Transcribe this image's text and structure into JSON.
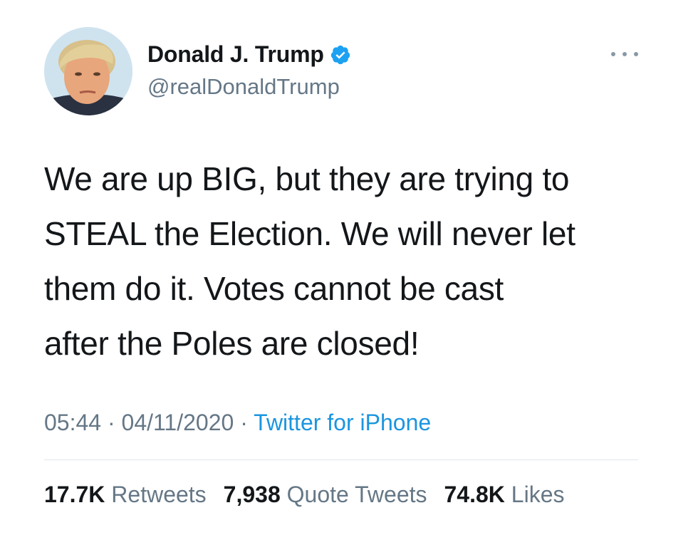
{
  "author": {
    "display_name": "Donald J. Trump",
    "handle": "@realDonaldTrump",
    "verified": true
  },
  "tweet": {
    "text": "We are up BIG, but they are trying to STEAL the Election. We will never let them do it. Votes cannot be cast after the Poles are closed!",
    "lines": [
      "We are up BIG, but they are trying to",
      "STEAL the Election. We will never let",
      "them do it. Votes cannot be cast",
      "after the Poles are closed!"
    ],
    "time": "05:44",
    "date": "04/11/2020",
    "separator": "·",
    "source": "Twitter for iPhone"
  },
  "stats": {
    "retweets_count": "17.7K",
    "retweets_label": "Retweets",
    "quotes_count": "7,938",
    "quotes_label": "Quote Tweets",
    "likes_count": "74.8K",
    "likes_label": "Likes"
  },
  "icons": {
    "verified": "verified-badge-icon",
    "more": "more-options-icon"
  },
  "colors": {
    "text_primary": "#14171a",
    "text_secondary": "#657786",
    "link": "#1b95e0",
    "verified": "#1da1f2",
    "divider": "#e1e8ed"
  }
}
